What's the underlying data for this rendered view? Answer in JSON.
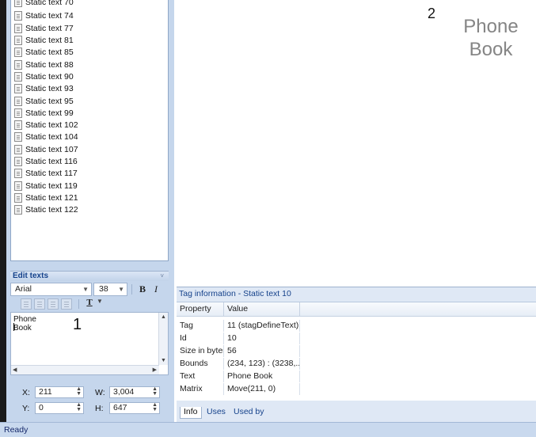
{
  "tag_list": {
    "items": [
      "Static text 70",
      "Static text 74",
      "Static text 77",
      "Static text 81",
      "Static text 85",
      "Static text 88",
      "Static text 90",
      "Static text 93",
      "Static text 95",
      "Static text 99",
      "Static text 102",
      "Static text 104",
      "Static text 107",
      "Static text 116",
      "Static text 117",
      "Static text 119",
      "Static text 121",
      "Static text 122"
    ]
  },
  "edit_texts": {
    "header": "Edit texts",
    "collapse_glyph": "˅",
    "font": "Arial",
    "size": "38",
    "bold_label": "B",
    "italic_label": "I",
    "underline_label": "T",
    "text_value": "Phone\nBook",
    "marker": "1",
    "x_label": "X:",
    "x_value": "211",
    "y_label": "Y:",
    "y_value": "0",
    "w_label": "W:",
    "w_value": "3,004",
    "h_label": "H:",
    "h_value": "647"
  },
  "preview": {
    "page_number": "2",
    "title_line1": "Phone",
    "title_line2": "Book"
  },
  "tag_info": {
    "title": "Tag information - Static text 10",
    "columns": [
      "Property",
      "Value"
    ],
    "rows": [
      {
        "property": "Tag",
        "value": "11 (stagDefineText)"
      },
      {
        "property": "Id",
        "value": "10"
      },
      {
        "property": "Size in bytes",
        "value": "56"
      },
      {
        "property": "Bounds",
        "value": "(234, 123) : (3238,..."
      },
      {
        "property": "Text",
        "value": "Phone  Book"
      },
      {
        "property": "Matrix",
        "value": "Move(211, 0)"
      }
    ],
    "tabs": [
      "Info",
      "Uses",
      "Used by"
    ]
  },
  "status": {
    "text": "Ready"
  }
}
